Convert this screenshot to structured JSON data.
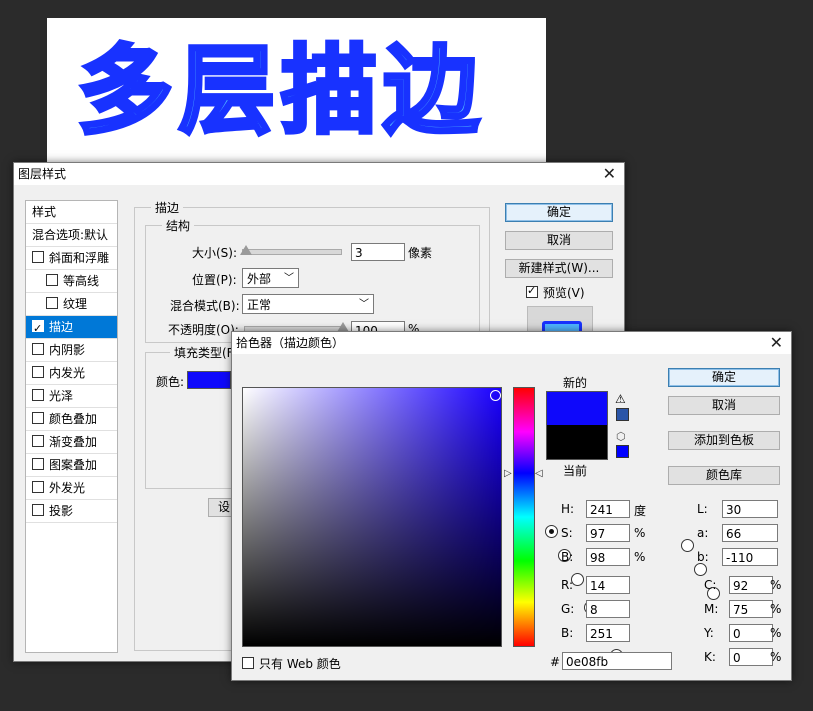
{
  "canvas": {
    "text": "多层描边"
  },
  "layer_style": {
    "title": "图层样式",
    "list_header": "样式",
    "blend_options": "混合选项:默认",
    "items": [
      {
        "label": "斜面和浮雕",
        "checked": false,
        "indent": false
      },
      {
        "label": "等高线",
        "checked": false,
        "indent": true
      },
      {
        "label": "纹理",
        "checked": false,
        "indent": true
      },
      {
        "label": "描边",
        "checked": true,
        "indent": false,
        "selected": true
      },
      {
        "label": "内阴影",
        "checked": false,
        "indent": false
      },
      {
        "label": "内发光",
        "checked": false,
        "indent": false
      },
      {
        "label": "光泽",
        "checked": false,
        "indent": false
      },
      {
        "label": "颜色叠加",
        "checked": false,
        "indent": false
      },
      {
        "label": "渐变叠加",
        "checked": false,
        "indent": false
      },
      {
        "label": "图案叠加",
        "checked": false,
        "indent": false
      },
      {
        "label": "外发光",
        "checked": false,
        "indent": false
      },
      {
        "label": "投影",
        "checked": false,
        "indent": false
      }
    ],
    "section_title": "描边",
    "structure_title": "结构",
    "size_label": "大小(S):",
    "size_value": "3",
    "size_unit": "像素",
    "position_label": "位置(P):",
    "position_value": "外部",
    "blend_mode_label": "混合模式(B):",
    "blend_mode_value": "正常",
    "opacity_label": "不透明度(O):",
    "opacity_value": "100",
    "opacity_unit": "%",
    "fill_type_label": "填充类型(F",
    "color_label": "颜色:",
    "stroke_color": "#0e08fb",
    "set_button_partial": "设",
    "ok": "确定",
    "cancel": "取消",
    "new_style": "新建样式(W)...",
    "preview_label": "预览(V)",
    "preview_checked": true
  },
  "color_picker": {
    "title": "拾色器（描边颜色）",
    "new_label": "新的",
    "current_label": "当前",
    "new_color": "#0e08fb",
    "current_color": "#000000",
    "ok": "确定",
    "cancel": "取消",
    "add_swatch": "添加到色板",
    "color_library": "颜色库",
    "fields_left": [
      {
        "name": "H:",
        "value": "241",
        "unit": "度",
        "selected": true
      },
      {
        "name": "S:",
        "value": "97",
        "unit": "%",
        "selected": false
      },
      {
        "name": "B:",
        "value": "98",
        "unit": "%",
        "selected": false
      },
      {
        "name": "R:",
        "value": "14",
        "unit": "",
        "selected": false
      },
      {
        "name": "G:",
        "value": "8",
        "unit": "",
        "selected": false
      },
      {
        "name": "B:",
        "value": "251",
        "unit": "",
        "selected": false
      }
    ],
    "fields_lab": [
      {
        "name": "L:",
        "value": "30"
      },
      {
        "name": "a:",
        "value": "66"
      },
      {
        "name": "b:",
        "value": "-110"
      }
    ],
    "fields_cmyk": [
      {
        "name": "C:",
        "value": "92",
        "unit": "%"
      },
      {
        "name": "M:",
        "value": "75",
        "unit": "%"
      },
      {
        "name": "Y:",
        "value": "0",
        "unit": "%"
      },
      {
        "name": "K:",
        "value": "0",
        "unit": "%"
      }
    ],
    "hex_label": "#",
    "hex_value": "0e08fb",
    "web_only_label": "只有 Web 颜色",
    "hue_color": "#1a00ff",
    "warning_swatch": "#2a55a8",
    "web_swatch": "#0000ff"
  }
}
